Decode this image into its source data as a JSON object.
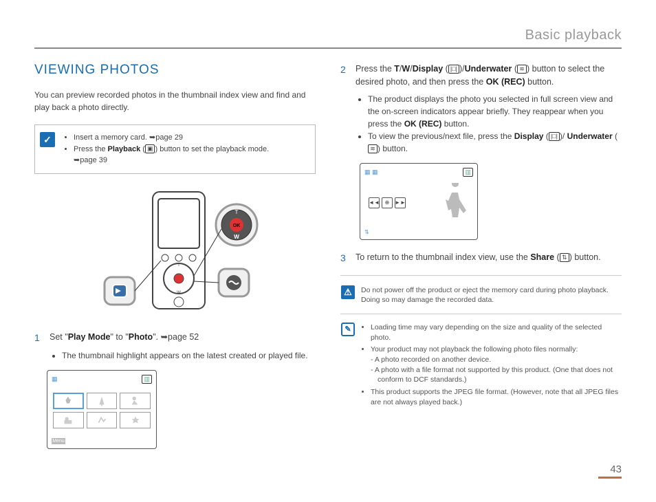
{
  "header": {
    "title": "Basic playback"
  },
  "left": {
    "section_title": "VIEWING PHOTOS",
    "intro": "You can preview recorded photos in the thumbnail index view and find and play back a photo directly.",
    "infobox": {
      "line1a": "Insert a memory card. ",
      "line1b": "➥page 29",
      "line2a": "Press the ",
      "line2b": "Playback",
      "line2c": " (",
      "line2d": ") button to set the playback mode. ",
      "line2e": "➥page 39"
    },
    "step1": {
      "num": "1",
      "pre": "Set \"",
      "b1": "Play Mode",
      "mid": "\" to \"",
      "b2": "Photo",
      "post": "\". ➥page 52",
      "sub1": "The thumbnail highlight appears on the latest created or played file."
    },
    "thumb_menu": "Menu"
  },
  "right": {
    "step2": {
      "num": "2",
      "t1": "Press the ",
      "b1": "T",
      "slash1": "/",
      "b2": "W",
      "slash2": "/",
      "b3": "Display",
      "paren1": " (",
      "paren1c": ")/",
      "b4": "Underwater",
      "paren2": " (",
      "paren2c": ") button to select the desired photo, and then press the ",
      "b5": "OK (REC)",
      "tail": " button.",
      "sub1a": "The product displays the photo you selected in full screen view and the on-screen indicators appear briefly. They reappear when you press the ",
      "sub1b": "OK (REC)",
      "sub1c": " button.",
      "sub2a": "To view the previous/next file, press the ",
      "sub2b": "Display",
      "sub2m": " (",
      "sub2m2": ")/ ",
      "sub2c": "Underwater",
      "sub2d": " (",
      "sub2e": ") button."
    },
    "step3": {
      "num": "3",
      "t1": "To return to the thumbnail index view, use the ",
      "b1": "Share",
      "t2": " (",
      "t3": ") button."
    },
    "warning": "Do not power off the product or eject the memory card during photo playback. Doing so may damage the recorded data.",
    "notes": {
      "n1": "Loading time may vary depending on the size and quality of the selected photo.",
      "n2": "Your product may not playback the following photo files normally:",
      "n2a": "A photo recorded on another device.",
      "n2b": "A photo with a file format not supported by this product. (One that does not conform to DCF standards.)",
      "n3": "This product supports the JPEG file format. (However, note that all JPEG files are not always played back.)"
    }
  },
  "glyphs": {
    "playback": "▣",
    "display": "|□|",
    "underwater": "≋",
    "share": "⇅",
    "battery": "▥"
  },
  "page_number": "43"
}
